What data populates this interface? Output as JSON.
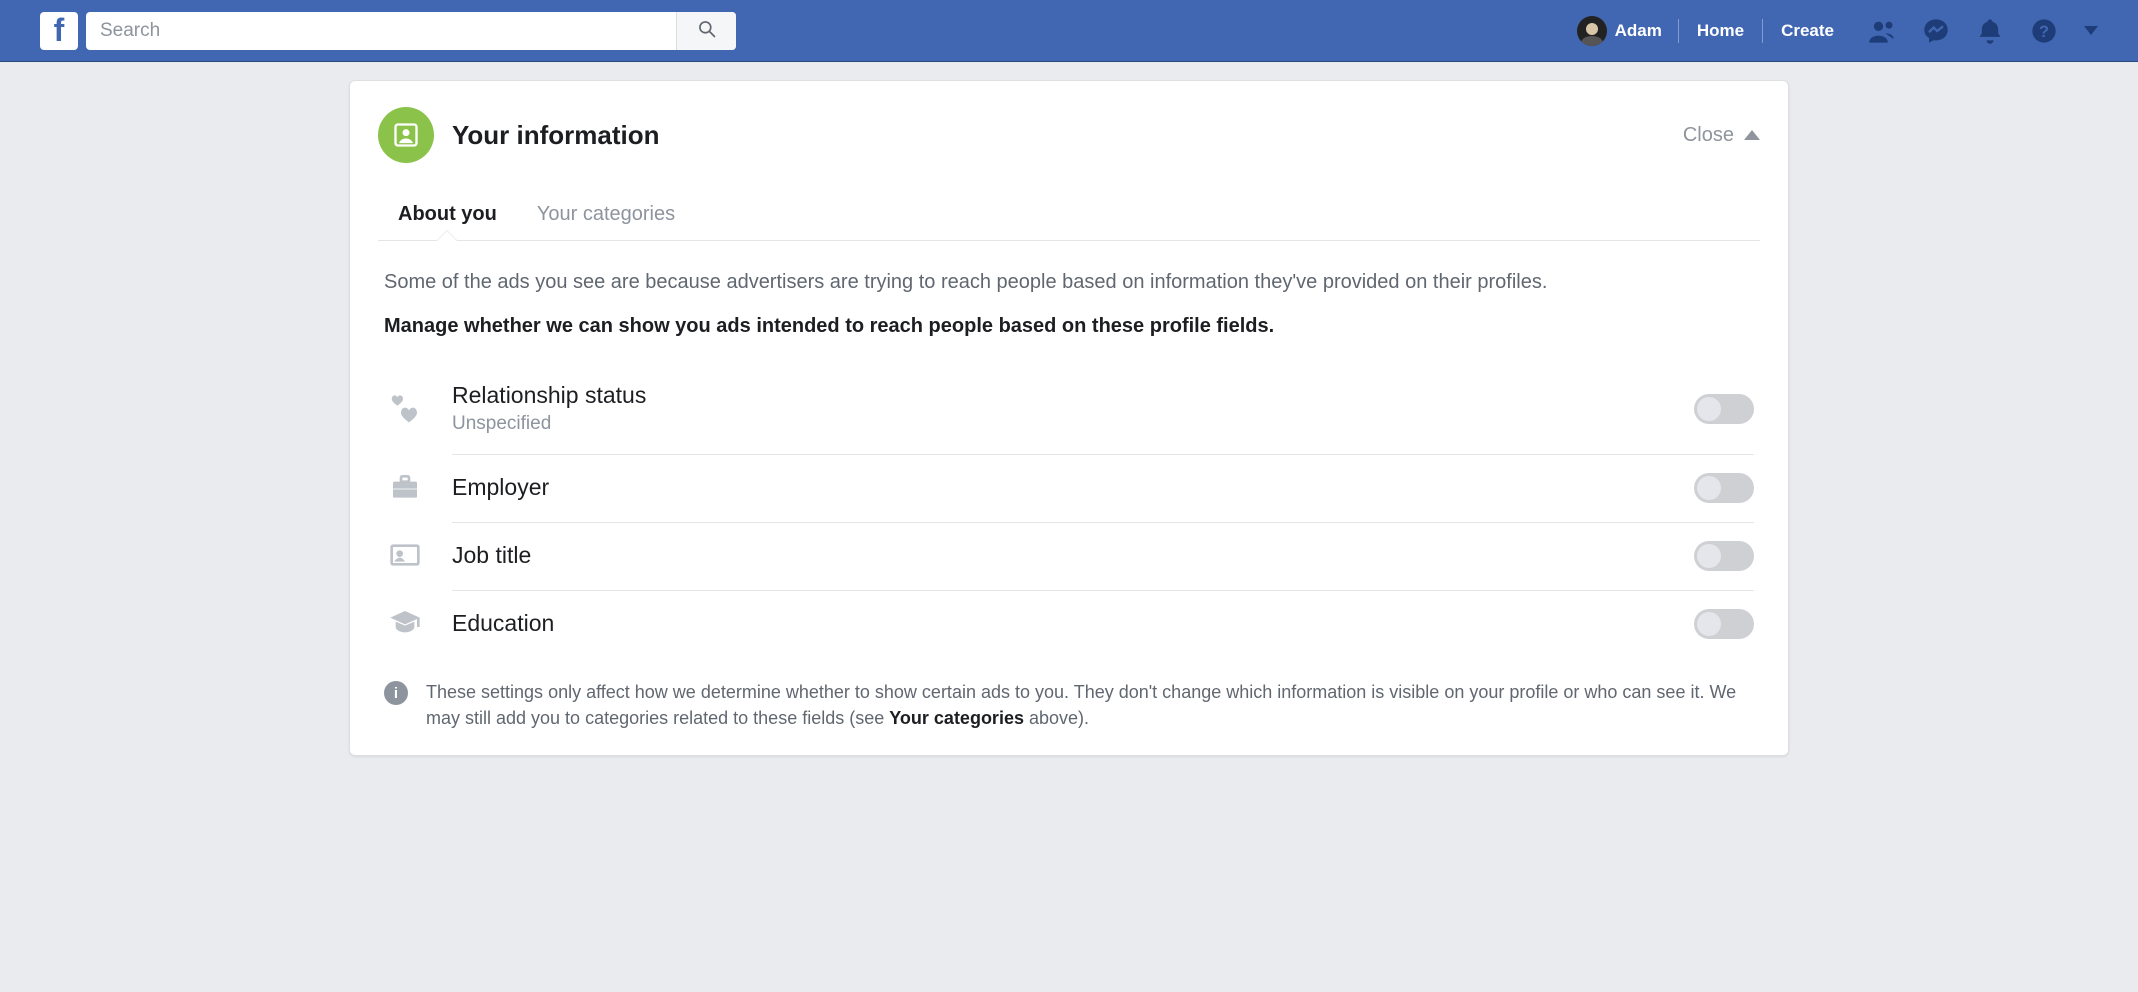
{
  "topbar": {
    "search_placeholder": "Search",
    "profile_name": "Adam",
    "home_label": "Home",
    "create_label": "Create"
  },
  "card": {
    "title": "Your information",
    "close_label": "Close"
  },
  "tabs": {
    "about_you": "About you",
    "your_categories": "Your categories"
  },
  "intro": {
    "light": "Some of the ads you see are because advertisers are trying to reach people based on information they've provided on their profiles.",
    "bold": "Manage whether we can show you ads intended to reach people based on these profile fields."
  },
  "rows": {
    "relationship": {
      "title": "Relationship status",
      "sub": "Unspecified"
    },
    "employer": {
      "title": "Employer"
    },
    "job_title": {
      "title": "Job title"
    },
    "education": {
      "title": "Education"
    }
  },
  "note": {
    "pre": "These settings only affect how we determine whether to show certain ads to you. They don't change which information is visible on your profile or who can see it. We may still add you to categories related to these fields (see ",
    "bold": "Your categories",
    "post": " above)."
  }
}
